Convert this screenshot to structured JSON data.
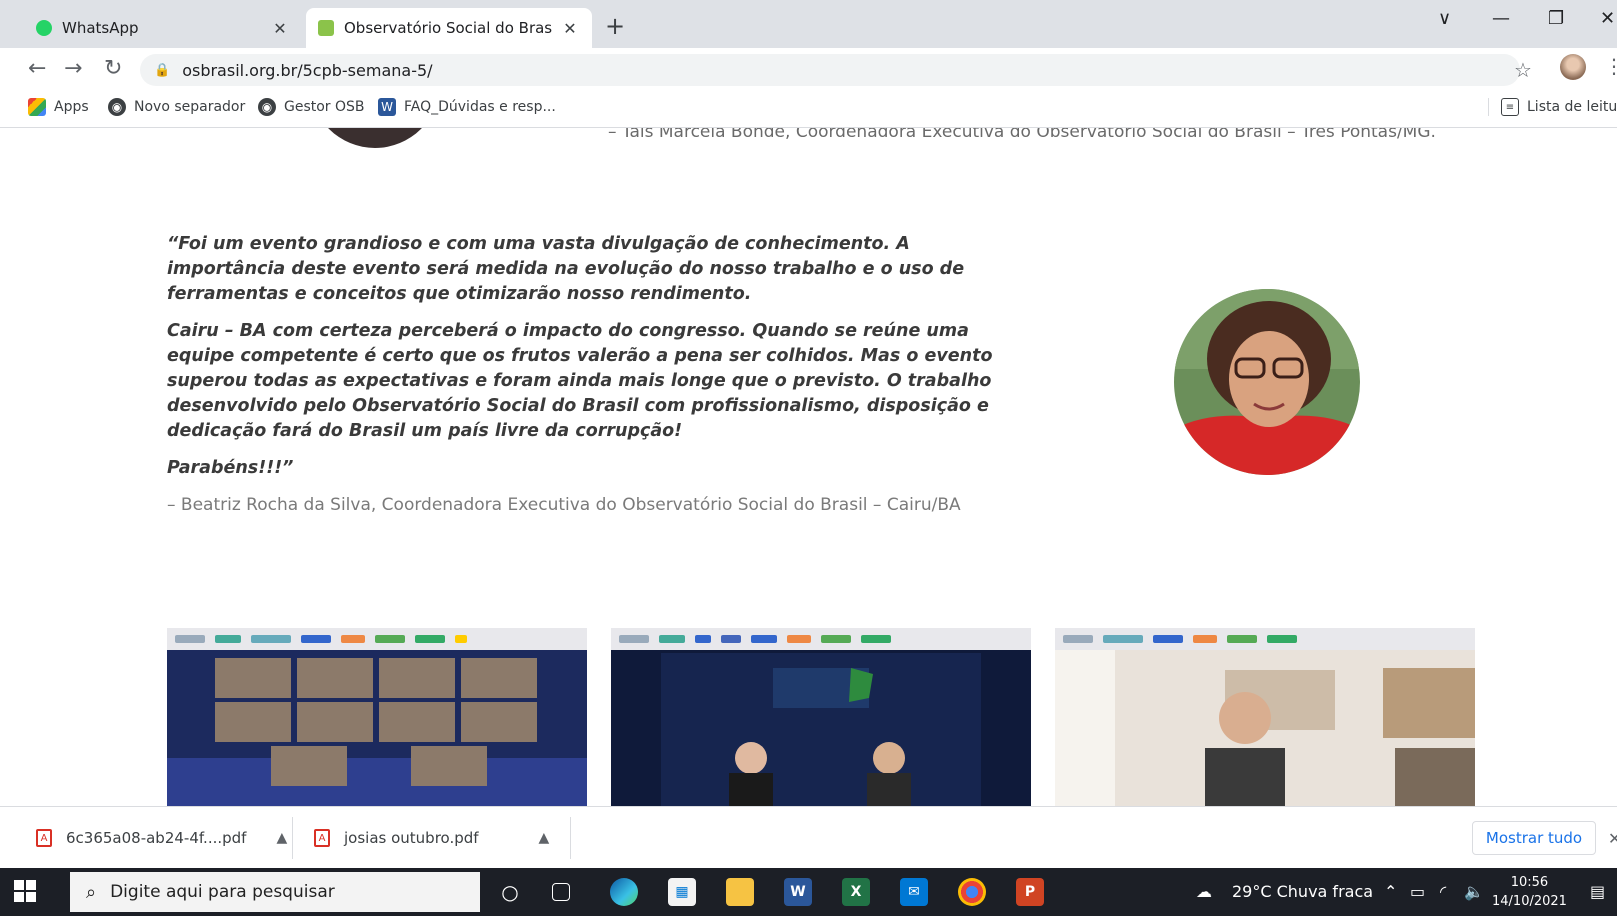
{
  "browser": {
    "tabs": [
      {
        "title": "WhatsApp",
        "favicon_color": "#25d366"
      },
      {
        "title": "Observatório Social do Brasil » U",
        "favicon_color": "#8bc34a"
      }
    ],
    "new_tab": "+",
    "window_controls": {
      "dropdown": "∨",
      "minimize": "—",
      "restore": "❐",
      "close": "✕"
    },
    "url": "osbrasil.org.br/5cpb-semana-5/",
    "bookmarks": [
      {
        "label": "Apps",
        "icon": "apps-grid-icon"
      },
      {
        "label": "Novo separador",
        "icon": "globe-icon"
      },
      {
        "label": "Gestor OSB",
        "icon": "globe-icon"
      },
      {
        "label": "FAQ_Dúvidas e resp...",
        "icon": "word-doc-icon"
      }
    ],
    "reading_list": "Lista de leitura"
  },
  "page": {
    "previous_caption": "– Taís Marcela Bonde, Coordenadora Executiva do Observatório Social do Brasil – Três Pontas/MG.",
    "testimonial": {
      "paragraphs": [
        "“Foi um evento grandioso e com uma vasta divulgação de conhecimento. A importância deste evento será medida na evolução do nosso trabalho e o uso de ferramentas e conceitos que otimizarão nosso rendimento.",
        "Cairu – BA com certeza perceberá o impacto do congresso. Quando se reúne uma equipe competente é certo que os frutos valerão a pena ser colhidos. Mas o evento superou todas as expectativas e foram ainda mais longe que o previsto. O trabalho desenvolvido pelo Observatório Social do Brasil com profissionalismo, disposição e dedicação fará do Brasil um país livre da corrupção!",
        "Parabéns!!!”"
      ],
      "author": "– Beatriz Rocha da Silva, Coordenadora Executiva do Observatório Social do Brasil – Cairu/BA"
    }
  },
  "downloads": {
    "items": [
      {
        "name": "6c365a08-ab24-4f....pdf"
      },
      {
        "name": "josias outubro.pdf"
      }
    ],
    "show_all": "Mostrar tudo"
  },
  "taskbar": {
    "search_placeholder": "Digite aqui para pesquisar",
    "weather": "29°C  Chuva fraca",
    "time": "10:56",
    "date": "14/10/2021"
  }
}
